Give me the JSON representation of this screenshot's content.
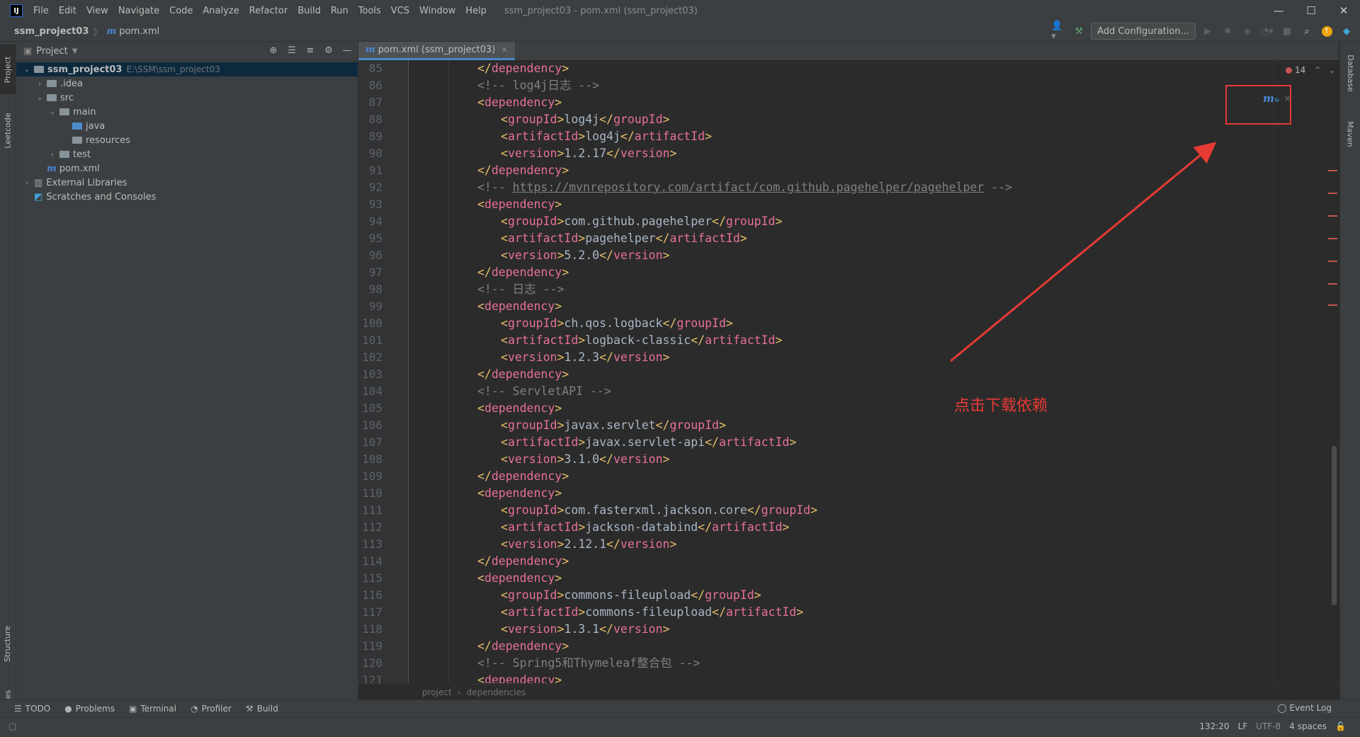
{
  "window": {
    "logo": "IJ",
    "title": "ssm_project03 - pom.xml (ssm_project03)",
    "controls": [
      "—",
      "☐",
      "✕"
    ]
  },
  "menu": [
    "File",
    "Edit",
    "View",
    "Navigate",
    "Code",
    "Analyze",
    "Refactor",
    "Build",
    "Run",
    "Tools",
    "VCS",
    "Window",
    "Help"
  ],
  "breadcrumb": {
    "project": "ssm_project03",
    "file": "pom.xml"
  },
  "toolbar": {
    "run_config": "Add Configuration..."
  },
  "left_stripe": {
    "project": "Project",
    "leetcode": "Leetcode",
    "structure": "Structure",
    "favorites": "Favorites"
  },
  "right_stripe": {
    "database": "Database",
    "maven": "Maven"
  },
  "project_panel": {
    "title": "Project",
    "tree": [
      {
        "label": "ssm_project03",
        "extra": "E:\\SSM\\ssm_project03",
        "depth": 0,
        "chevron": "down",
        "icon": "module"
      },
      {
        "label": ".idea",
        "depth": 1,
        "chevron": "right",
        "icon": "folder"
      },
      {
        "label": "src",
        "depth": 1,
        "chevron": "down",
        "icon": "folder"
      },
      {
        "label": "main",
        "depth": 2,
        "chevron": "down",
        "icon": "folder"
      },
      {
        "label": "java",
        "depth": 3,
        "chevron": "",
        "icon": "folder-blue"
      },
      {
        "label": "resources",
        "depth": 3,
        "chevron": "",
        "icon": "folder-res"
      },
      {
        "label": "test",
        "depth": 2,
        "chevron": "right",
        "icon": "folder"
      },
      {
        "label": "pom.xml",
        "depth": 1,
        "chevron": "",
        "icon": "maven"
      },
      {
        "label": "External Libraries",
        "depth": 0,
        "chevron": "right",
        "icon": "library"
      },
      {
        "label": "Scratches and Consoles",
        "depth": 0,
        "chevron": "",
        "icon": "scratch"
      }
    ]
  },
  "editor": {
    "tab": "pom.xml (ssm_project03)",
    "error_count": "14",
    "lines": [
      {
        "n": "85",
        "indent": 1,
        "kind": "close",
        "name": "dependency"
      },
      {
        "n": "86",
        "indent": 1,
        "kind": "comment",
        "text": "<!-- log4j日志 -->"
      },
      {
        "n": "87",
        "indent": 1,
        "kind": "open",
        "name": "dependency"
      },
      {
        "n": "88",
        "indent": 2,
        "kind": "elem",
        "name": "groupId",
        "value": "log4j"
      },
      {
        "n": "89",
        "indent": 2,
        "kind": "elem",
        "name": "artifactId",
        "value": "log4j"
      },
      {
        "n": "90",
        "indent": 2,
        "kind": "elem",
        "name": "version",
        "value": "1.2.17"
      },
      {
        "n": "91",
        "indent": 1,
        "kind": "close",
        "name": "dependency"
      },
      {
        "n": "92",
        "indent": 1,
        "kind": "urlcomment",
        "pre": "<!-- ",
        "url": "https://mvnrepository.com/artifact/com.github.pagehelper/pagehelper",
        "post": " -->"
      },
      {
        "n": "93",
        "indent": 1,
        "kind": "open",
        "name": "dependency"
      },
      {
        "n": "94",
        "indent": 2,
        "kind": "elem",
        "name": "groupId",
        "value": "com.github.pagehelper"
      },
      {
        "n": "95",
        "indent": 2,
        "kind": "elem",
        "name": "artifactId",
        "value": "pagehelper"
      },
      {
        "n": "96",
        "indent": 2,
        "kind": "elem",
        "name": "version",
        "value": "5.2.0"
      },
      {
        "n": "97",
        "indent": 1,
        "kind": "close",
        "name": "dependency"
      },
      {
        "n": "98",
        "indent": 1,
        "kind": "comment",
        "text": "<!-- 日志 -->"
      },
      {
        "n": "99",
        "indent": 1,
        "kind": "open",
        "name": "dependency"
      },
      {
        "n": "100",
        "indent": 2,
        "kind": "elem",
        "name": "groupId",
        "value": "ch.qos.logback"
      },
      {
        "n": "101",
        "indent": 2,
        "kind": "elem",
        "name": "artifactId",
        "value": "logback-classic"
      },
      {
        "n": "102",
        "indent": 2,
        "kind": "elem",
        "name": "version",
        "value": "1.2.3"
      },
      {
        "n": "103",
        "indent": 1,
        "kind": "close",
        "name": "dependency"
      },
      {
        "n": "104",
        "indent": 1,
        "kind": "comment",
        "text": "<!-- ServletAPI -->"
      },
      {
        "n": "105",
        "indent": 1,
        "kind": "open",
        "name": "dependency"
      },
      {
        "n": "106",
        "indent": 2,
        "kind": "elem",
        "name": "groupId",
        "value": "javax.servlet"
      },
      {
        "n": "107",
        "indent": 2,
        "kind": "elem",
        "name": "artifactId",
        "value": "javax.servlet-api"
      },
      {
        "n": "108",
        "indent": 2,
        "kind": "elem",
        "name": "version",
        "value": "3.1.0"
      },
      {
        "n": "109",
        "indent": 1,
        "kind": "close",
        "name": "dependency"
      },
      {
        "n": "110",
        "indent": 1,
        "kind": "open",
        "name": "dependency"
      },
      {
        "n": "111",
        "indent": 2,
        "kind": "elem",
        "name": "groupId",
        "value": "com.fasterxml.jackson.core"
      },
      {
        "n": "112",
        "indent": 2,
        "kind": "elem",
        "name": "artifactId",
        "value": "jackson-databind"
      },
      {
        "n": "113",
        "indent": 2,
        "kind": "elem",
        "name": "version",
        "value": "2.12.1"
      },
      {
        "n": "114",
        "indent": 1,
        "kind": "close",
        "name": "dependency"
      },
      {
        "n": "115",
        "indent": 1,
        "kind": "open",
        "name": "dependency"
      },
      {
        "n": "116",
        "indent": 2,
        "kind": "elem",
        "name": "groupId",
        "value": "commons-fileupload"
      },
      {
        "n": "117",
        "indent": 2,
        "kind": "elem",
        "name": "artifactId",
        "value": "commons-fileupload"
      },
      {
        "n": "118",
        "indent": 2,
        "kind": "elem",
        "name": "version",
        "value": "1.3.1"
      },
      {
        "n": "119",
        "indent": 1,
        "kind": "close",
        "name": "dependency"
      },
      {
        "n": "120",
        "indent": 1,
        "kind": "comment",
        "text": "<!-- Spring5和Thymeleaf整合包 -->"
      },
      {
        "n": "121",
        "indent": 1,
        "kind": "open",
        "name": "dependency"
      }
    ],
    "crumbs": [
      "project",
      "dependencies"
    ]
  },
  "annotation": "点击下载依赖",
  "tool_windows": [
    "TODO",
    "Problems",
    "Terminal",
    "Profiler",
    "Build"
  ],
  "event_log": "Event Log",
  "status": {
    "position": "132:20",
    "line_sep": "LF",
    "encoding": "UTF-8",
    "indent": "4 spaces"
  },
  "colors": {
    "tag": "#e8709a",
    "bracket": "#e8bf6a",
    "comment": "#808080",
    "text": "#a9b7c6",
    "annotation": "#e83a35",
    "error": "#c75450"
  }
}
